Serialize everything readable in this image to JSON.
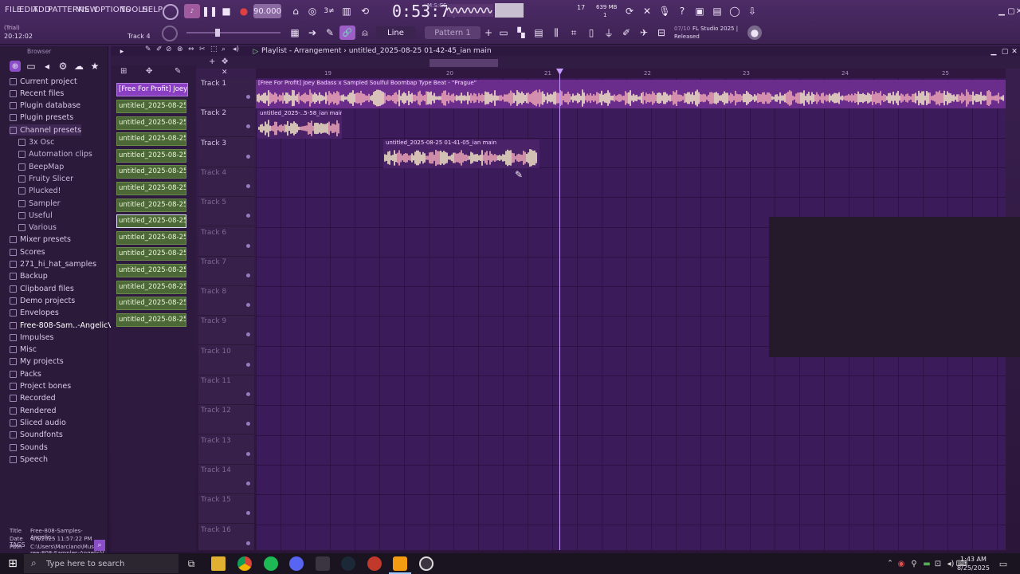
{
  "window": {
    "trial_label": "(Trial)",
    "time_display": "20:12:02",
    "track_hint": "Track 4",
    "tempo": "90.000",
    "timecode": "0:53:73",
    "timecode_unit": "M:S:CS",
    "cpu_label": "17",
    "memory_label": "639 MB",
    "memory_sub": "1",
    "snap_mode": "Line",
    "pattern": "Pattern 1",
    "news_counter": "07/10",
    "news_title": "FL Studio 2025 |",
    "news_sub": "Released"
  },
  "menu": [
    "FILE",
    "EDIT",
    "ADD",
    "PATTERNS",
    "VIEW",
    "OPTIONS",
    "TOOLS",
    "HELP"
  ],
  "browser": {
    "title": "Browser",
    "items": [
      {
        "label": "Current project",
        "indent": false
      },
      {
        "label": "Recent files",
        "indent": false
      },
      {
        "label": "Plugin database",
        "indent": false
      },
      {
        "label": "Plugin presets",
        "indent": false
      },
      {
        "label": "Channel presets",
        "indent": false,
        "highlight": true
      },
      {
        "label": "3x Osc",
        "indent": true
      },
      {
        "label": "Automation clips",
        "indent": true
      },
      {
        "label": "BeepMap",
        "indent": true
      },
      {
        "label": "Fruity Slicer",
        "indent": true
      },
      {
        "label": "Plucked!",
        "indent": true
      },
      {
        "label": "Sampler",
        "indent": true
      },
      {
        "label": "Useful",
        "indent": true
      },
      {
        "label": "Various",
        "indent": true
      },
      {
        "label": "Mixer presets",
        "indent": false
      },
      {
        "label": "Scores",
        "indent": false
      },
      {
        "label": "271_hi_hat_samples",
        "indent": false
      },
      {
        "label": "Backup",
        "indent": false
      },
      {
        "label": "Clipboard files",
        "indent": false
      },
      {
        "label": "Demo projects",
        "indent": false
      },
      {
        "label": "Envelopes",
        "indent": false
      },
      {
        "label": "Free-808-Sam..-AngelicVibes",
        "indent": false,
        "bold": true
      },
      {
        "label": "Impulses",
        "indent": false
      },
      {
        "label": "Misc",
        "indent": false
      },
      {
        "label": "My projects",
        "indent": false
      },
      {
        "label": "Packs",
        "indent": false
      },
      {
        "label": "Project bones",
        "indent": false
      },
      {
        "label": "Recorded",
        "indent": false
      },
      {
        "label": "Rendered",
        "indent": false
      },
      {
        "label": "Sliced audio",
        "indent": false
      },
      {
        "label": "Soundfonts",
        "indent": false
      },
      {
        "label": "Sounds",
        "indent": false
      },
      {
        "label": "Speech",
        "indent": false
      }
    ],
    "info": {
      "title_key": "Title",
      "title_val": "Free-808-Samples-Angelic..",
      "date_key": "Date",
      "date_val": "4/6/2025 11:57:22 PM",
      "path_key": "Path",
      "path_val": "C:\\Users\\Marciano\\Music\\Free-808-Samples-AngelicVibes"
    },
    "tags_label": "TAGS"
  },
  "playlist": {
    "title": "Playlist - Arrangement",
    "breadcrumb": "untitled_2025-08-25 01-42-45_ian main",
    "ruler": [
      "19",
      "20",
      "21",
      "22",
      "23",
      "24",
      "25"
    ]
  },
  "clip_list": {
    "first": "[Free For Profit] Joey..",
    "items": [
      "untitled_2025-08-25 01-..",
      "untitled_2025-08-25 01-..",
      "untitled_2025-08-25 01-..",
      "untitled_2025-08-25 01-..",
      "untitled_2025-08-25 01-..",
      "untitled_2025-08-25 01-..",
      "untitled_2025-08-25 01-..",
      "untitled_2025-08-25 01-..",
      "untitled_2025-08-25 01-..",
      "untitled_2025-08-25 01-..",
      "untitled_2025-08-25 01-..",
      "untitled_2025-08-25 01-..",
      "untitled_2025-08-25 01-..",
      "untitled_2025-08-25 01-.."
    ],
    "selected_index": 7
  },
  "tracks": [
    "Track 1",
    "Track 2",
    "Track 3",
    "Track 4",
    "Track 5",
    "Track 6",
    "Track 7",
    "Track 8",
    "Track 9",
    "Track 10",
    "Track 11",
    "Track 12",
    "Track 13",
    "Track 14",
    "Track 15",
    "Track 16"
  ],
  "audio_clips": [
    {
      "label": "[Free For Profit] Joey Badass x Sampled Soulful Boombap Type Beat - \"Prague\"",
      "track": 1
    },
    {
      "label": "untitled_2025-..5-58_ian main",
      "track": 2
    },
    {
      "label": "untitled_2025-08-25 01-41-05_ian main",
      "track": 3
    }
  ],
  "taskbar": {
    "search_placeholder": "Type here to search",
    "time": "1:43 AM",
    "date": "8/25/2025"
  }
}
